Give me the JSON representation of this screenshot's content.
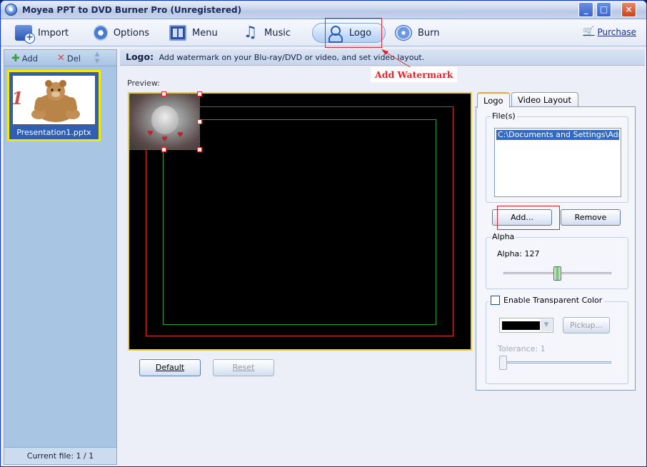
{
  "window": {
    "title": "Moyea PPT to DVD Burner Pro (Unregistered)",
    "controls": {
      "minimize": "_",
      "maximize": "□",
      "close": "×"
    }
  },
  "toolbar": {
    "items": [
      {
        "label": "Import",
        "icon": "import-icon"
      },
      {
        "label": "Options",
        "icon": "options-icon"
      },
      {
        "label": "Menu",
        "icon": "menu-icon"
      },
      {
        "label": "Music",
        "icon": "music-icon"
      },
      {
        "label": "Logo",
        "icon": "logo-icon",
        "active": true
      },
      {
        "label": "Burn",
        "icon": "burn-icon"
      }
    ],
    "purchase_label": "Purchase"
  },
  "annotation": {
    "label": "Add Watermark",
    "color": "#e4232b"
  },
  "left_panel": {
    "add_label": "Add",
    "del_label": "Del",
    "slides": [
      {
        "number": "1",
        "caption": "Presentation1.pptx"
      }
    ],
    "footer": "Current file: 1 / 1"
  },
  "main": {
    "header_title": "Logo:",
    "header_desc": "Add watermark on your Blu-ray/DVD or video, and set video layout.",
    "preview_label": "Preview:",
    "default_label": "Default",
    "reset_label": "Reset"
  },
  "logo_tab": {
    "tabs": [
      "Logo",
      "Video Layout"
    ],
    "files_group": "File(s)",
    "files": [
      "C:\\Documents and Settings\\Adminis"
    ],
    "add_button": "Add...",
    "remove_button": "Remove",
    "alpha_group": "Alpha",
    "alpha_label": "Alpha: 127",
    "alpha_value": 127,
    "alpha_max": 255,
    "transparent_label": "Enable Transparent Color",
    "transparent_checked": false,
    "transparent_color": "#000000",
    "pickup_label": "Pickup...",
    "tolerance_label": "Tolerance: 1"
  },
  "colors": {
    "accent_red": "#e4232b",
    "preview_border": "#e9cd48",
    "safe_outer": "#e0262c",
    "safe_inner": "#1fa41f"
  }
}
